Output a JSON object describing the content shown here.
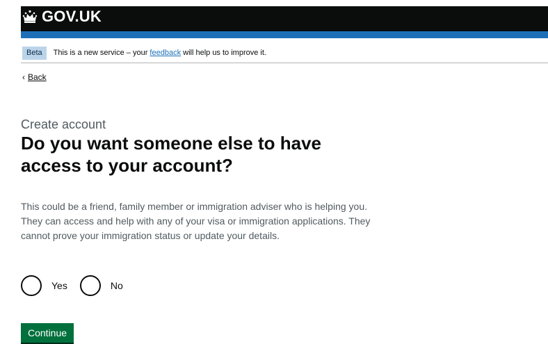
{
  "header": {
    "logo_text": "GOV.UK",
    "logo_icon": "crown-icon"
  },
  "phase_banner": {
    "tag": "Beta",
    "text_before": "This is a new service – your ",
    "link": "feedback",
    "text_after": " will help us to improve it."
  },
  "back_link": {
    "chevron": "‹",
    "label": "Back"
  },
  "form": {
    "caption": "Create account",
    "heading": "Do you want someone else to have access to your account?",
    "hint": "This could be a friend, family member or immigration adviser who is helping you. They can access and help with any of your visa or immigration applications. They cannot prove your immigration status or update your details.",
    "options": [
      {
        "label": "Yes",
        "selected": false
      },
      {
        "label": "No",
        "selected": false
      }
    ],
    "continue_label": "Continue"
  },
  "colors": {
    "header_bg": "#0b0c0c",
    "header_stripe": "#1d70b8",
    "link": "#1d70b8",
    "button_green": "#00703c",
    "phase_tag_bg": "#bbd4ea"
  }
}
